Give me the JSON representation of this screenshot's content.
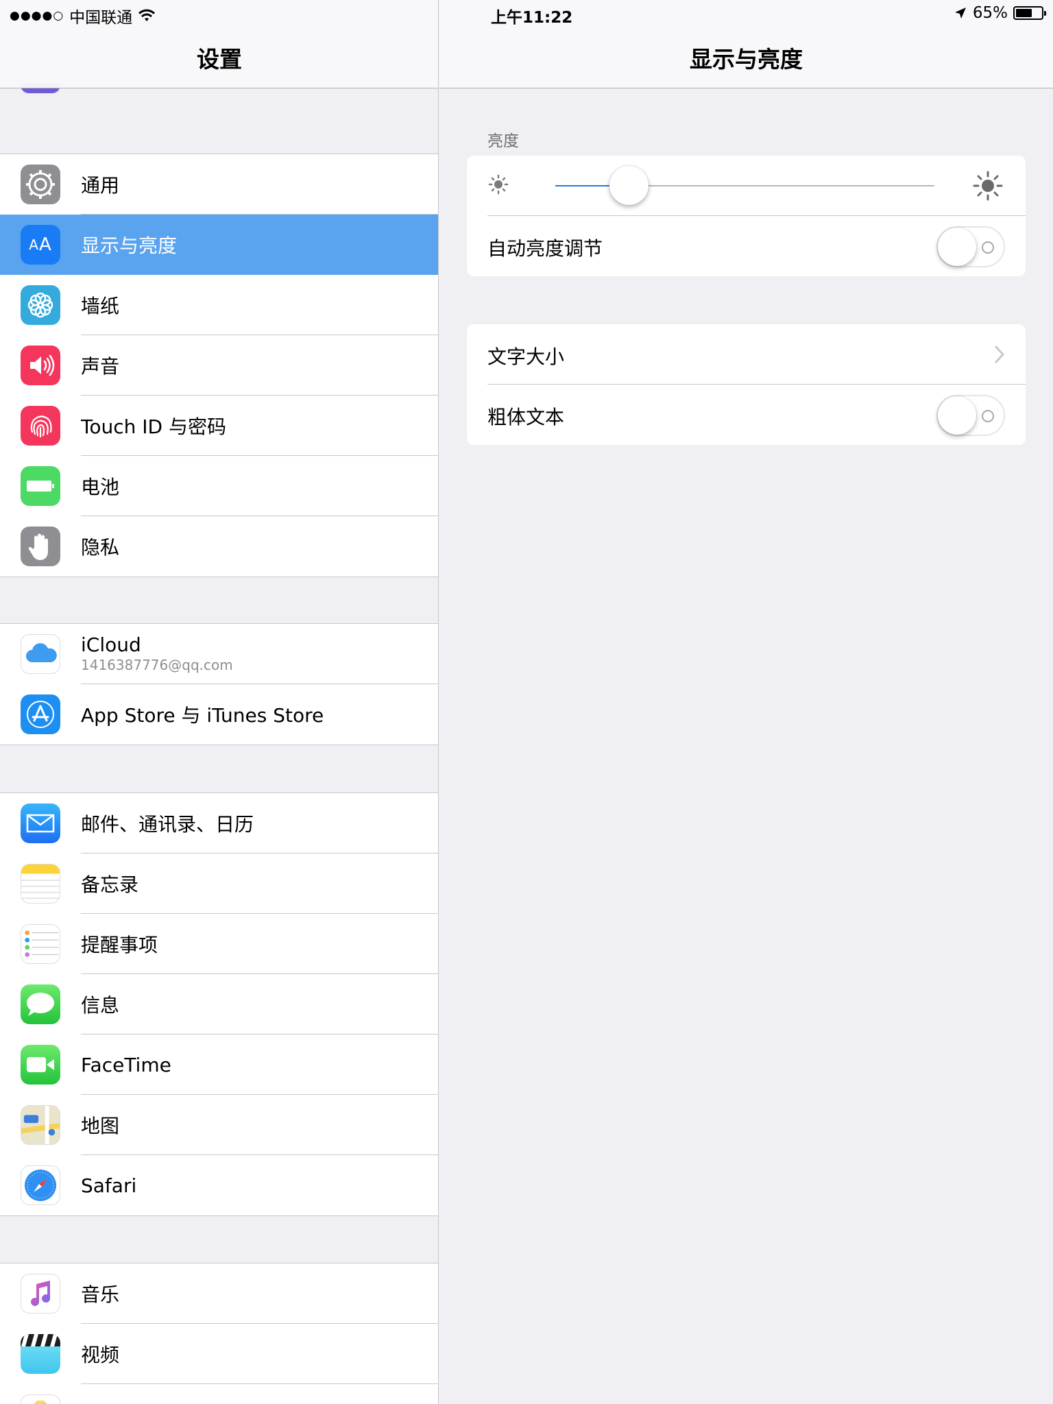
{
  "status_bar": {
    "signal": "●●●●○",
    "carrier": "中国联通",
    "time": "上午11:22",
    "battery": "65%",
    "battery_level": 0.65
  },
  "master": {
    "title": "设置",
    "groups": [
      [
        {
          "label": "通用",
          "icon": "gear-icon",
          "color": "#8e8e93"
        },
        {
          "label": "显示与亮度",
          "icon": "display-brightness-icon",
          "color": "#1a7cf5",
          "selected": true
        },
        {
          "label": "墙纸",
          "icon": "wallpaper-flower-icon",
          "color": "#35aadc"
        },
        {
          "label": "声音",
          "icon": "speaker-icon",
          "color": "#f5365c"
        },
        {
          "label": "Touch ID 与密码",
          "icon": "fingerprint-icon",
          "color": "#f5365c"
        },
        {
          "label": "电池",
          "icon": "battery-icon",
          "color": "#4cd964"
        },
        {
          "label": "隐私",
          "icon": "hand-icon",
          "color": "#8e8e93"
        }
      ],
      [
        {
          "label": "iCloud",
          "sublabel": "1416387776@qq.com",
          "icon": "icloud-icon",
          "color": "#ffffff"
        },
        {
          "label": "App Store 与 iTunes Store",
          "icon": "app-store-icon",
          "color": "#1d8ff2"
        }
      ],
      [
        {
          "label": "邮件、通讯录、日历",
          "icon": "mail-icon",
          "color": "#1e86f6"
        },
        {
          "label": "备忘录",
          "icon": "notes-icon",
          "color": "#ffffff"
        },
        {
          "label": "提醒事项",
          "icon": "reminders-icon",
          "color": "#ffffff"
        },
        {
          "label": "信息",
          "icon": "messages-icon",
          "color": "#4cd964"
        },
        {
          "label": "FaceTime",
          "icon": "facetime-icon",
          "color": "#4cd964"
        },
        {
          "label": "地图",
          "icon": "maps-icon",
          "color": "#e8e2c8"
        },
        {
          "label": "Safari",
          "icon": "safari-icon",
          "color": "#ffffff"
        }
      ],
      [
        {
          "label": "音乐",
          "icon": "music-note-icon",
          "color": "#ffffff"
        },
        {
          "label": "视频",
          "icon": "videos-clapper-icon",
          "color": "#4ad0f0"
        }
      ]
    ]
  },
  "detail": {
    "title": "显示与亮度",
    "brightness_header": "亮度",
    "brightness_level": 0.16,
    "auto_brightness_label": "自动亮度调节",
    "auto_brightness_on": false,
    "text_size_label": "文字大小",
    "bold_text_label": "粗体文本",
    "bold_text_on": false
  },
  "colors": {
    "accent": "#007aff",
    "selected_row": "#5aa4ef",
    "background": "#efeff4"
  }
}
